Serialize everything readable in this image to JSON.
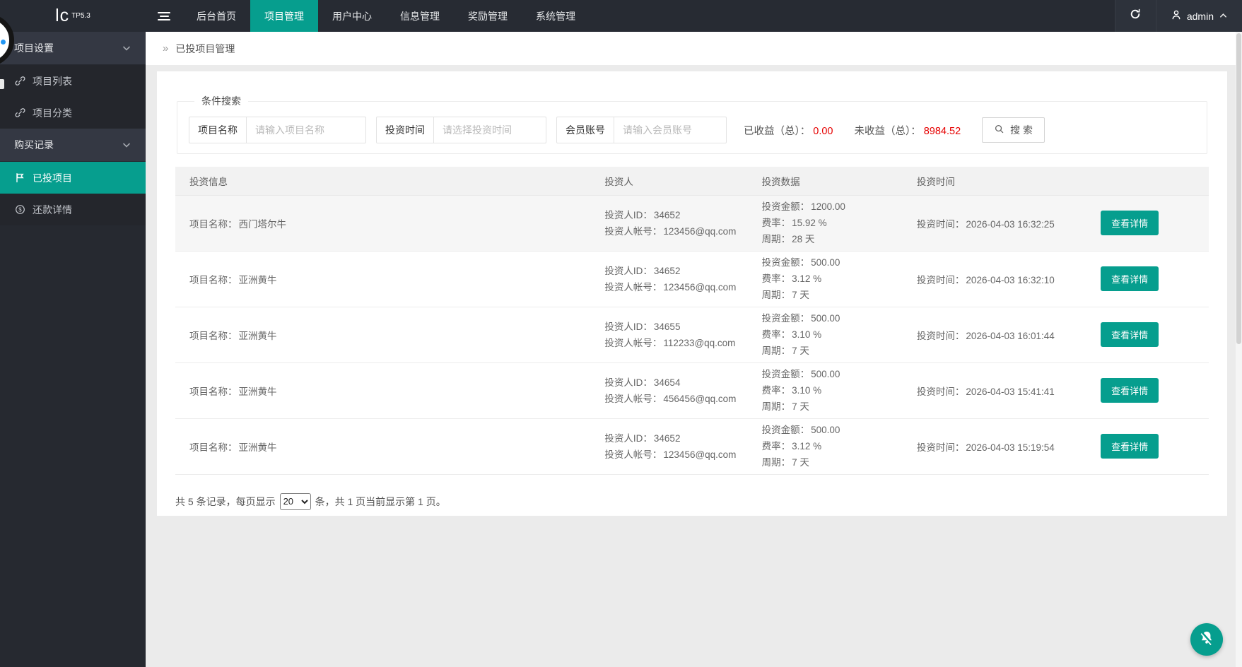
{
  "topbar": {
    "logo": "lc",
    "logo_sup": "TP5.3",
    "nav": [
      {
        "label": "后台首页",
        "active": false
      },
      {
        "label": "项目管理",
        "active": true
      },
      {
        "label": "用户中心",
        "active": false
      },
      {
        "label": "信息管理",
        "active": false
      },
      {
        "label": "奖励管理",
        "active": false
      },
      {
        "label": "系统管理",
        "active": false
      }
    ],
    "user": {
      "name": "admin"
    }
  },
  "sidebar": {
    "groups": [
      {
        "label": "项目设置",
        "items": [
          {
            "label": "项目列表",
            "icon": "link-icon",
            "active": false
          },
          {
            "label": "项目分类",
            "icon": "link-icon",
            "active": false
          }
        ]
      },
      {
        "label": "购买记录",
        "items": [
          {
            "label": "已投项目",
            "icon": "flag-icon",
            "active": true
          },
          {
            "label": "还款详情",
            "icon": "dollar-circle-icon",
            "active": false
          }
        ]
      }
    ]
  },
  "breadcrumb": {
    "arrow": "»",
    "title": "已投项目管理"
  },
  "search": {
    "legend": "条件搜索",
    "fields": [
      {
        "label": "项目名称",
        "placeholder": "请输入项目名称",
        "value": ""
      },
      {
        "label": "投资时间",
        "placeholder": "请选择投资时间",
        "value": ""
      },
      {
        "label": "会员账号",
        "placeholder": "请输入会员账号",
        "value": ""
      }
    ],
    "totals": [
      {
        "label": "已收益（总）：",
        "value": "0.00"
      },
      {
        "label": "未收益（总）：",
        "value": "8984.52"
      }
    ],
    "button_label": "搜 索"
  },
  "table": {
    "headers": [
      "投资信息",
      "投资人",
      "投资数据",
      "投资时间"
    ],
    "labels": {
      "project": "项目名称：",
      "investor_id": "投资人ID：",
      "investor_account": "投资人帐号：",
      "amount": "投资金额：",
      "rate": "费率：",
      "cycle": "周期：",
      "time": "投资时间："
    },
    "action_label": "查看详情",
    "rows": [
      {
        "project": "西门塔尔牛",
        "investor_id": "34652",
        "investor_account": "123456@qq.com",
        "amount": "1200.00",
        "rate": "15.92 %",
        "cycle": "28 天",
        "time": "2026-04-03 16:32:25"
      },
      {
        "project": "亚洲黄牛",
        "investor_id": "34652",
        "investor_account": "123456@qq.com",
        "amount": "500.00",
        "rate": "3.12 %",
        "cycle": "7 天",
        "time": "2026-04-03 16:32:10"
      },
      {
        "project": "亚洲黄牛",
        "investor_id": "34655",
        "investor_account": "112233@qq.com",
        "amount": "500.00",
        "rate": "3.10 %",
        "cycle": "7 天",
        "time": "2026-04-03 16:01:44"
      },
      {
        "project": "亚洲黄牛",
        "investor_id": "34654",
        "investor_account": "456456@qq.com",
        "amount": "500.00",
        "rate": "3.10 %",
        "cycle": "7 天",
        "time": "2026-04-03 15:41:41"
      },
      {
        "project": "亚洲黄牛",
        "investor_id": "34652",
        "investor_account": "123456@qq.com",
        "amount": "500.00",
        "rate": "3.12 %",
        "cycle": "7 天",
        "time": "2026-04-03 15:19:54"
      }
    ]
  },
  "pagination": {
    "prefix": "共 5 条记录，每页显示",
    "page_size": "20",
    "suffix": "条，共 1 页当前显示第 1 页。"
  },
  "icons": {
    "hamburger-icon": "three horizontal bars",
    "refresh-icon": "circular arrow",
    "user-icon": "person outline",
    "caret-up-icon": "chevron up",
    "chevron-down-icon": "chevron down",
    "link-icon": "chain link",
    "flag-icon": "flag",
    "dollar-circle-icon": "dollar sign in circle",
    "search-icon": "magnifier",
    "bell-slash-icon": "bell crossed out"
  },
  "colors": {
    "accent_teal": "#069e8e",
    "alert_red": "#e60000",
    "topbar_bg": "#272b33",
    "sidebar_bg": "#262930",
    "page_bg": "#ebebeb"
  }
}
